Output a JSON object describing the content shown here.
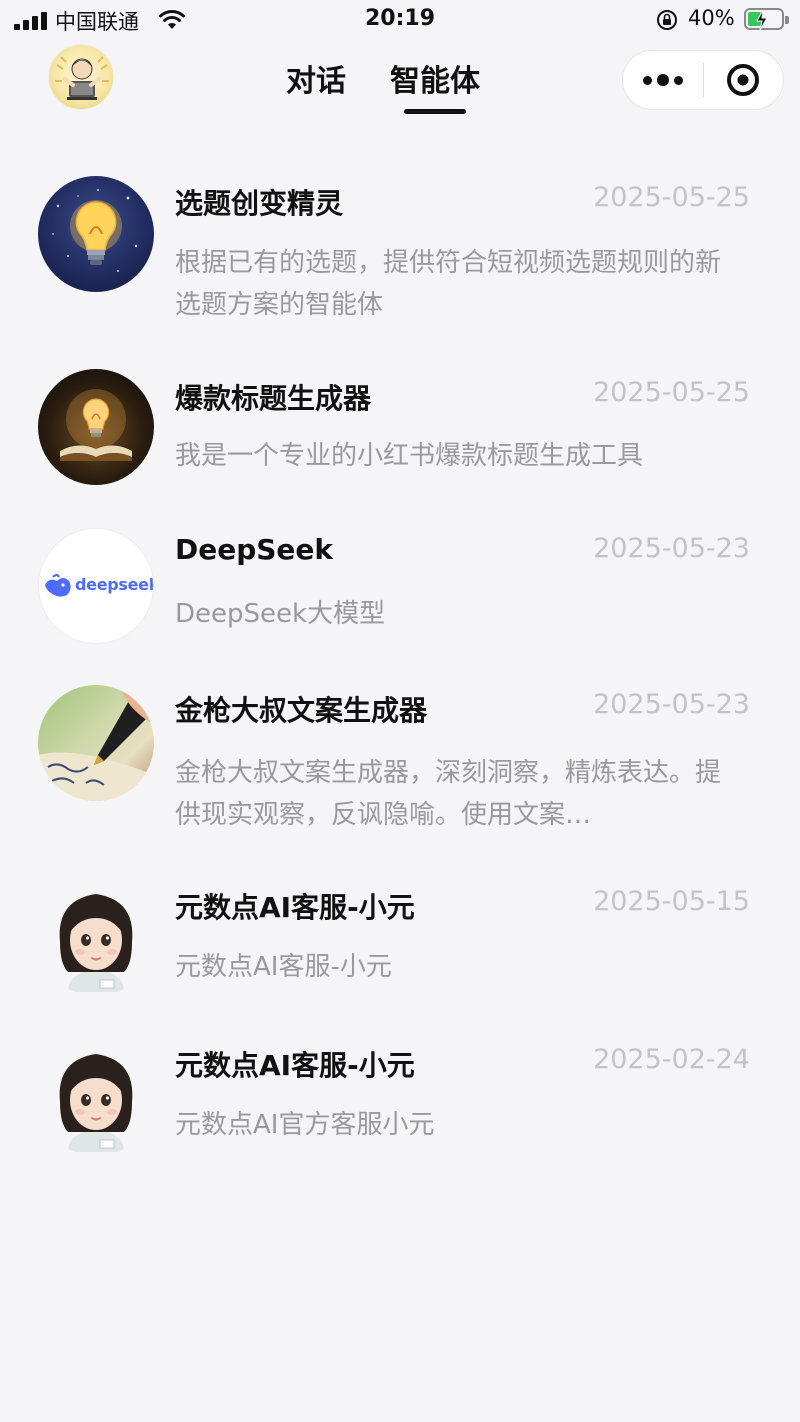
{
  "status_bar": {
    "carrier": "中国联通",
    "time": "20:19",
    "battery": "40%",
    "battery_level": 0.4
  },
  "header": {
    "tabs": [
      {
        "label": "对话",
        "active": false
      },
      {
        "label": "智能体",
        "active": true
      }
    ],
    "more_icon": "more-dots-icon",
    "close_icon": "target-close-icon"
  },
  "agents": [
    {
      "name": "选题创变精灵",
      "date": "2025-05-25",
      "desc": "根据已有的选题，提供符合短视频选题规则的新选题方案的智能体",
      "avatar": "lightbulb-night-avatar"
    },
    {
      "name": "爆款标题生成器",
      "date": "2025-05-25",
      "desc": "我是一个专业的小红书爆款标题生成工具",
      "avatar": "lightbulb-book-avatar"
    },
    {
      "name": "DeepSeek",
      "date": "2025-05-23",
      "desc": "DeepSeek大模型",
      "avatar": "deepseek-logo-avatar",
      "logo_text": "deepseek"
    },
    {
      "name": "金枪大叔文案生成器",
      "date": "2025-05-23",
      "desc": "金枪大叔文案生成器，深刻洞察，精炼表达。提供现实观察，反讽隐喻。使用文案…",
      "avatar": "fountain-pen-avatar"
    },
    {
      "name": "元数点AI客服-小元",
      "date": "2025-05-15",
      "desc": "元数点AI客服-小元",
      "avatar": "girl-avatar"
    },
    {
      "name": "元数点AI客服-小元",
      "date": "2025-02-24",
      "desc": "元数点AI官方客服小元",
      "avatar": "girl-avatar"
    }
  ]
}
